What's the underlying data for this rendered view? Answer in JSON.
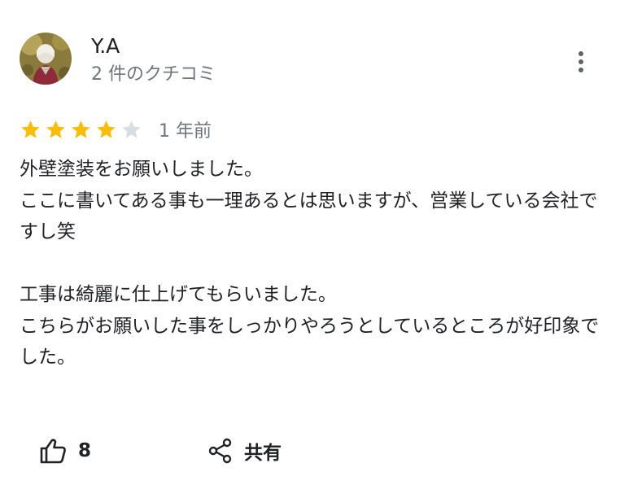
{
  "reviewer": {
    "name": "Y.A",
    "meta": "2 件のクチコミ"
  },
  "review": {
    "rating": 4,
    "max_rating": 5,
    "date": "1 年前",
    "paragraphs": [
      "外壁塗装をお願いしました。\nここに書いてある事も一理あるとは思いますが、営業している会社ですし笑",
      "工事は綺麗に仕上げてもらいました。\nこちらがお願いした事をしっかりやろうとしているところが好印象でした。"
    ]
  },
  "actions": {
    "like_count": "8",
    "share_label": "共有"
  },
  "colors": {
    "star_filled": "#fbbc04",
    "star_empty": "#dadce0",
    "secondary_text": "#70757a",
    "primary_text": "#202124"
  },
  "icons": {
    "menu": "more-vert-icon",
    "like": "thumb-up-icon",
    "share": "share-icon"
  }
}
